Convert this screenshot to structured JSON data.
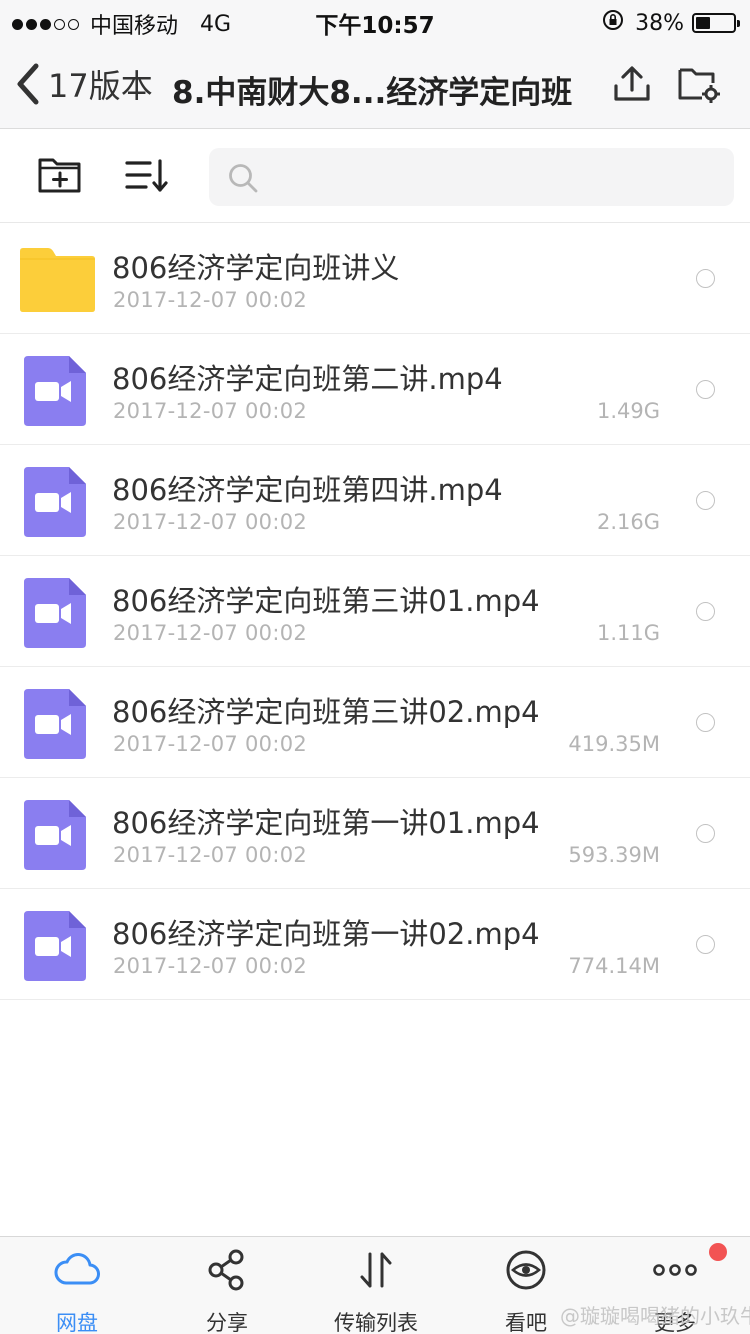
{
  "status_bar": {
    "carrier": "中国移动",
    "network": "4G",
    "time": "下午10:57",
    "battery_percent": "38%",
    "battery_level": 0.38
  },
  "nav": {
    "back_label": "17版本",
    "title": "8.中南财大8...经济学定向班"
  },
  "search": {
    "placeholder": ""
  },
  "files": [
    {
      "type": "folder",
      "name": "806经济学定向班讲义",
      "date": "2017-12-07 00:02",
      "size": ""
    },
    {
      "type": "video",
      "name": "806经济学定向班第二讲.mp4",
      "date": "2017-12-07 00:02",
      "size": "1.49G"
    },
    {
      "type": "video",
      "name": "806经济学定向班第四讲.mp4",
      "date": "2017-12-07 00:02",
      "size": "2.16G"
    },
    {
      "type": "video",
      "name": "806经济学定向班第三讲01.mp4",
      "date": "2017-12-07 00:02",
      "size": "1.11G"
    },
    {
      "type": "video",
      "name": "806经济学定向班第三讲02.mp4",
      "date": "2017-12-07 00:02",
      "size": "419.35M"
    },
    {
      "type": "video",
      "name": "806经济学定向班第一讲01.mp4",
      "date": "2017-12-07 00:02",
      "size": "593.39M"
    },
    {
      "type": "video",
      "name": "806经济学定向班第一讲02.mp4",
      "date": "2017-12-07 00:02",
      "size": "774.14M"
    }
  ],
  "tabs": [
    {
      "label": "网盘",
      "icon": "cloud-icon",
      "active": true
    },
    {
      "label": "分享",
      "icon": "share-icon",
      "active": false
    },
    {
      "label": "传输列表",
      "icon": "transfer-icon",
      "active": false
    },
    {
      "label": "看吧",
      "icon": "eye-icon",
      "active": false
    },
    {
      "label": "更多",
      "icon": "more-icon",
      "active": false
    }
  ],
  "watermark": "@璇璇喝喝猪的小玖牛",
  "colors": {
    "accent": "#3b8ef5",
    "folder": "#fcce3a",
    "video": "#8a7ef0",
    "badge": "#f25353"
  }
}
